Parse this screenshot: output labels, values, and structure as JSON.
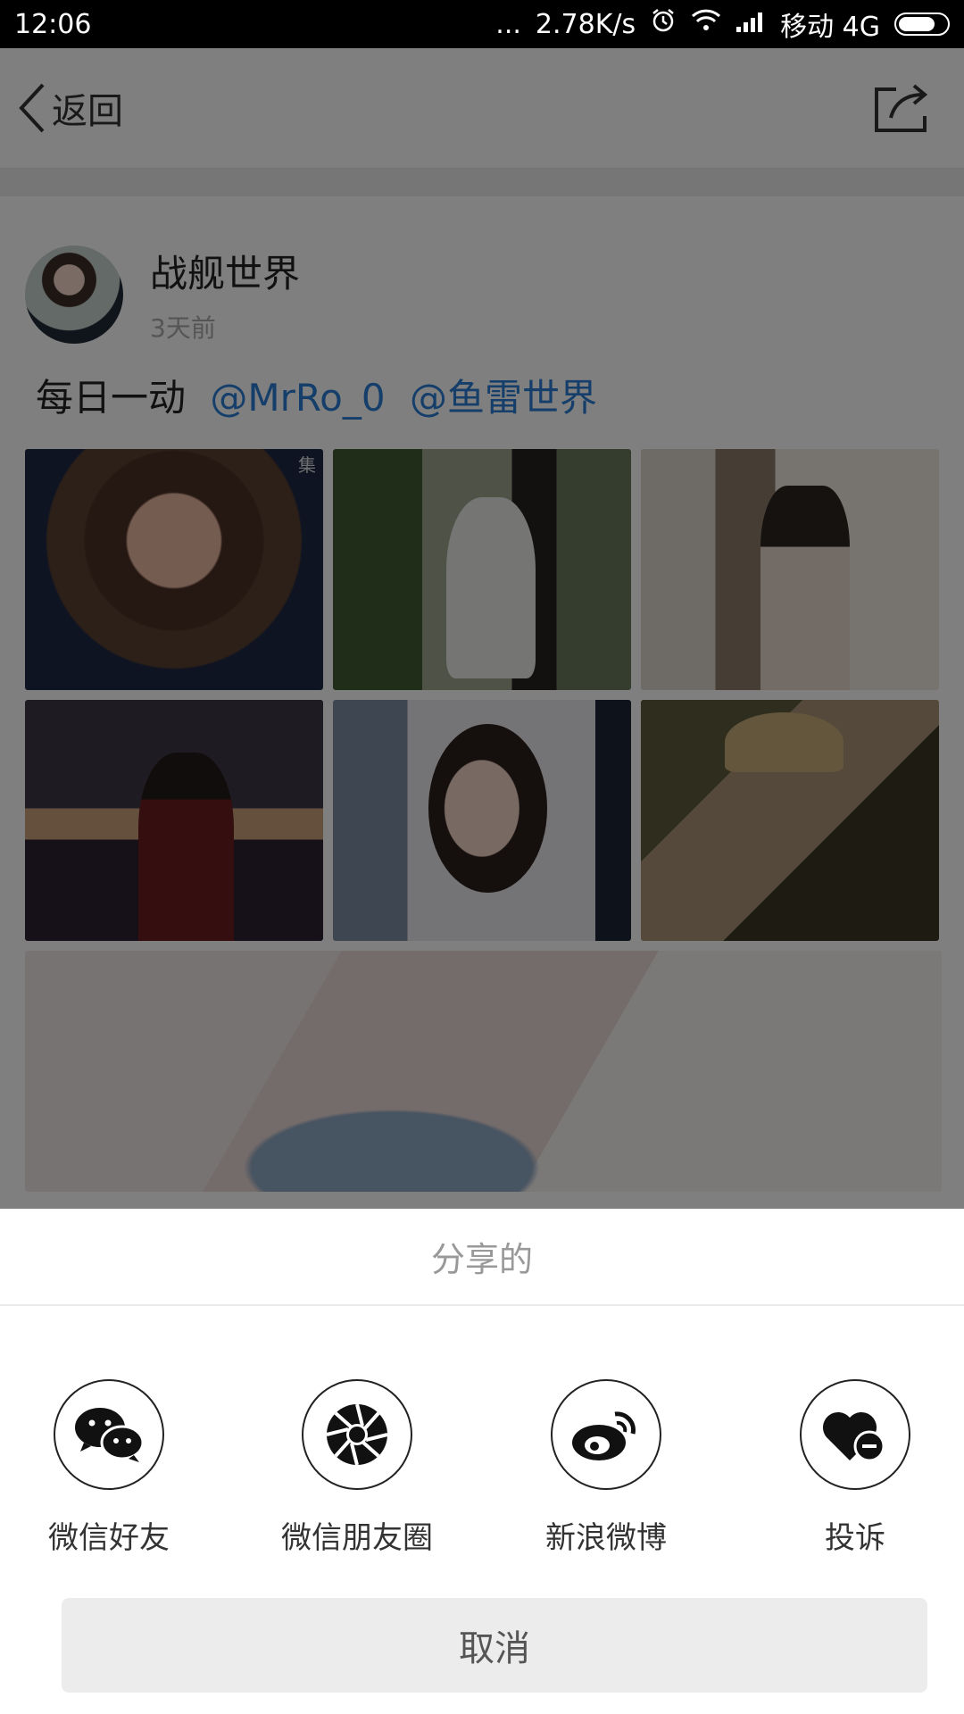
{
  "status_bar": {
    "time": "12:06",
    "dots": "...",
    "speed": "2.78K/s",
    "carrier": "移动 4G"
  },
  "nav": {
    "back_label": "返回"
  },
  "post": {
    "author": "战舰世界",
    "time_ago": "3天前",
    "text": "每日一动",
    "mentions": [
      "@MrRo_0",
      "@鱼雷世界"
    ],
    "watermark": "集"
  },
  "share_sheet": {
    "title": "分享的",
    "options": [
      {
        "label": "微信好友",
        "icon": "wechat-icon"
      },
      {
        "label": "微信朋友圈",
        "icon": "moments-icon"
      },
      {
        "label": "新浪微博",
        "icon": "weibo-icon"
      },
      {
        "label": "投诉",
        "icon": "report-heart-icon"
      }
    ],
    "cancel_label": "取消"
  }
}
